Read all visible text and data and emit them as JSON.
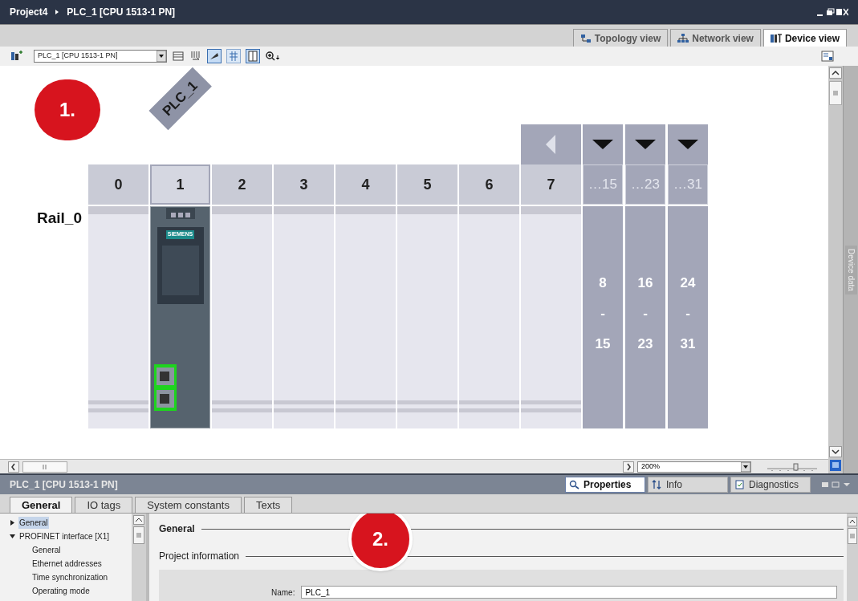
{
  "window": {
    "breadcrumb": [
      "Project4",
      "PLC_1 [CPU 1513-1 PN]"
    ]
  },
  "view_tabs": [
    {
      "label": "Topology view",
      "kind": "topology",
      "selected": false
    },
    {
      "label": "Network view",
      "kind": "network",
      "selected": false
    },
    {
      "label": "Device view",
      "kind": "device",
      "selected": true
    }
  ],
  "toolbar": {
    "device_select": "PLC_1 [CPU 1513-1 PN]"
  },
  "canvas": {
    "callout": "1.",
    "device_label": "PLC_1",
    "rail_label": "Rail_0",
    "slots": [
      {
        "label": "0",
        "kind": "empty",
        "selected": false
      },
      {
        "label": "1",
        "kind": "cpu",
        "selected": true,
        "brand": "SIEMENS"
      },
      {
        "label": "2",
        "kind": "empty",
        "selected": false
      },
      {
        "label": "3",
        "kind": "empty",
        "selected": false
      },
      {
        "label": "4",
        "kind": "empty",
        "selected": false
      },
      {
        "label": "5",
        "kind": "empty",
        "selected": false
      },
      {
        "label": "6",
        "kind": "empty",
        "selected": false
      },
      {
        "label": "7",
        "kind": "empty",
        "selected": false
      }
    ],
    "expansion_slots": [
      {
        "label": "…15",
        "range": [
          "8",
          "-",
          "15"
        ]
      },
      {
        "label": "…23",
        "range": [
          "16",
          "-",
          "23"
        ]
      },
      {
        "label": "…31",
        "range": [
          "24",
          "-",
          "31"
        ]
      }
    ],
    "side_tab": "Device data",
    "zoom": "200%"
  },
  "inspector": {
    "title": "PLC_1 [CPU 1513-1 PN]",
    "tabs": [
      {
        "label": "Properties",
        "selected": true
      },
      {
        "label": "Info",
        "selected": false
      },
      {
        "label": "Diagnostics",
        "selected": false
      }
    ],
    "sub_tabs": [
      {
        "label": "General",
        "selected": true
      },
      {
        "label": "IO tags",
        "selected": false
      },
      {
        "label": "System constants",
        "selected": false
      },
      {
        "label": "Texts",
        "selected": false
      }
    ],
    "tree": [
      {
        "label": "General",
        "selected": true,
        "expanded": false
      },
      {
        "label": "PROFINET interface [X1]",
        "selected": false,
        "expanded": true,
        "children": [
          {
            "label": "General"
          },
          {
            "label": "Ethernet addresses"
          },
          {
            "label": "Time synchronization"
          },
          {
            "label": "Operating mode"
          }
        ]
      }
    ],
    "section": "General",
    "callout": "2.",
    "subsection": "Project information",
    "fields": [
      {
        "label": "Name:",
        "value": "PLC_1"
      }
    ]
  }
}
